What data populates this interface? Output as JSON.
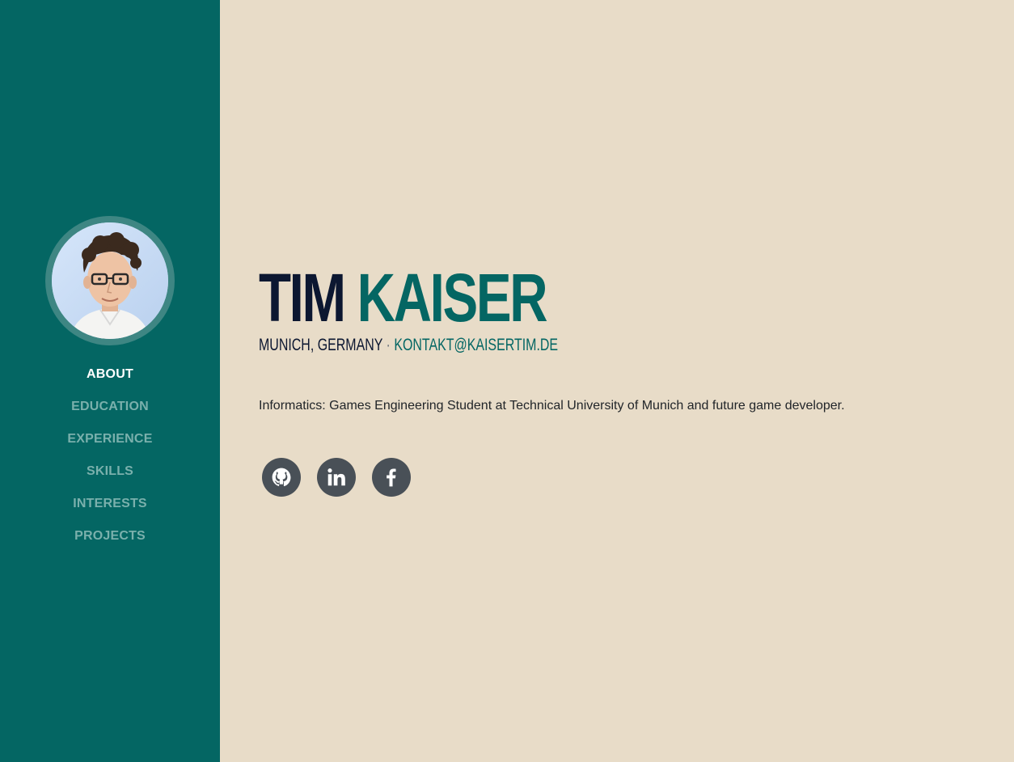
{
  "sidebar": {
    "avatar_alt": "Tim Kaiser portrait",
    "nav": [
      {
        "label": "ABOUT",
        "active": true
      },
      {
        "label": "EDUCATION",
        "active": false
      },
      {
        "label": "EXPERIENCE",
        "active": false
      },
      {
        "label": "SKILLS",
        "active": false
      },
      {
        "label": "INTERESTS",
        "active": false
      },
      {
        "label": "PROJECTS",
        "active": false
      }
    ]
  },
  "about": {
    "first_name": "TIM",
    "last_name": "KAISER",
    "location": "MUNICH, GERMANY",
    "separator": "·",
    "email": "KONTAKT@KAISERTIM.DE",
    "lead": "Informatics: Games Engineering Student at Technical University of Munich and future game developer."
  },
  "social": [
    {
      "icon": "github-icon"
    },
    {
      "icon": "linkedin-icon"
    },
    {
      "icon": "facebook-icon"
    }
  ],
  "colors": {
    "sidebar": "#046663",
    "background": "#e8dcc8",
    "accent": "#046663",
    "dark": "#0c1731",
    "nav_inactive": "#7ab0ac",
    "social_button": "#495057"
  }
}
